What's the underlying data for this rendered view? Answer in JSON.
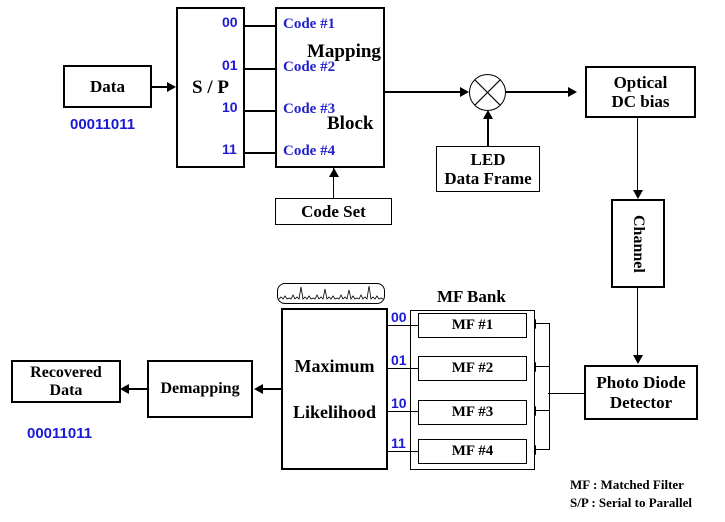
{
  "diagram": {
    "title": "Optical CDMA / VLC transceiver block diagram",
    "colors": {
      "line": "#000000",
      "blue_label": "#1a1ad6",
      "blue_code": "#2222cc",
      "background": "#ffffff"
    }
  },
  "transmitter": {
    "data_block": {
      "label": "Data",
      "bitstream": "00011011"
    },
    "sp_block": {
      "label": "S / P"
    },
    "sp_outputs": [
      "00",
      "01",
      "10",
      "11"
    ],
    "mapping_block": {
      "title_line1": "Mapping",
      "title_line2": "Block",
      "codes": [
        "Code #1",
        "Code #2",
        "Code #3",
        "Code #4"
      ]
    },
    "code_set_block": {
      "label": "Code Set"
    },
    "mixer": {
      "symbol": "multiplier"
    },
    "led_block": {
      "line1": "LED",
      "line2": "Data Frame"
    },
    "optical_dc_bias_block": {
      "line1": "Optical",
      "line2": "DC bias"
    }
  },
  "channel": {
    "label": "Channel"
  },
  "receiver": {
    "photo_diode_block": {
      "line1": "Photo Diode",
      "line2": "Detector"
    },
    "mf_bank": {
      "title": "MF Bank",
      "filters": [
        "MF #1",
        "MF #2",
        "MF #3",
        "MF #4"
      ],
      "inputs": [
        "00",
        "01",
        "10",
        "11"
      ]
    },
    "maximum_likelihood_block": {
      "line1": "Maximum",
      "line2": "Likelihood"
    },
    "demapping_block": {
      "label": "Demapping"
    },
    "recovered_data_block": {
      "label_line1": "Recovered",
      "label_line2": "Data",
      "bitstream": "00011011"
    }
  },
  "legend": {
    "line1": "MF : Matched Filter",
    "line2": "S/P : Serial to Parallel"
  }
}
